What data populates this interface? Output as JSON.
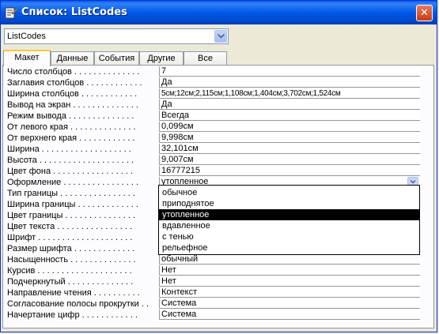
{
  "window": {
    "title": "Список: ListCodes"
  },
  "object_select": {
    "value": "ListCodes"
  },
  "tabs": [
    "Макет",
    "Данные",
    "События",
    "Другие",
    "Все"
  ],
  "active_tab": "Макет",
  "properties": [
    {
      "label": "Число столбцов . . . . . . . . . . . . . .",
      "value": "7"
    },
    {
      "label": "Заглавия столбцов . . . . . . . . . . . .",
      "value": "Да"
    },
    {
      "label": "Ширина столбцов . . . . . . . . . . . .",
      "value": "5см;12см;2,115см;1,108см;1,404см;3,702см;1,524см"
    },
    {
      "label": "Вывод на экран . . . . . . . . . . . . . .",
      "value": "Да"
    },
    {
      "label": "Режим вывода . . . . . . . . . . . . . .",
      "value": "Всегда"
    },
    {
      "label": "От левого края . . . . . . . . . . . . . .",
      "value": "0,099см"
    },
    {
      "label": "От верхнего края . . . . . . . . . . . .",
      "value": "9,998см"
    },
    {
      "label": "Ширина . . . . . . . . . . . . . . . . . . .",
      "value": "32,101см"
    },
    {
      "label": "Высота . . . . . . . . . . . . . . . . . . . .",
      "value": "9,007см"
    },
    {
      "label": "Цвет фона . . . . . . . . . . . . . . . . .",
      "value": "16777215"
    },
    {
      "label": "Оформление . . . . . . . . . . . . . . . .",
      "value": "утопленное"
    },
    {
      "label": "Тип границы . . . . . . . . . . . . . . . .",
      "value": ""
    },
    {
      "label": "Ширина границы . . . . . . . . . . . . .",
      "value": ""
    },
    {
      "label": "Цвет границы . . . . . . . . . . . . . . .",
      "value": ""
    },
    {
      "label": "Цвет текста . . . . . . . . . . . . . . . .",
      "value": ""
    },
    {
      "label": "Шрифт . . . . . . . . . . . . . . . . . . . .",
      "value": ""
    },
    {
      "label": "Размер шрифта . . . . . . . . . . . . .",
      "value": ""
    },
    {
      "label": "Насыщенность . . . . . . . . . . . . . .",
      "value": "обычный"
    },
    {
      "label": "Курсив . . . . . . . . . . . . . . . . . . . .",
      "value": "Нет"
    },
    {
      "label": "Подчеркнутый . . . . . . . . . . . . . .",
      "value": "Нет"
    },
    {
      "label": "Направление чтения . . . . . . . . . .",
      "value": "Контекст"
    },
    {
      "label": "Согласование полосы прокрутки . .",
      "value": "Система"
    },
    {
      "label": "Начертание цифр . . . . . . . . . . . .",
      "value": "Система"
    }
  ],
  "dropdown": {
    "options": [
      "обычное",
      "приподнятое",
      "утопленное",
      "вдавленное",
      "с тенью",
      "рельефное"
    ],
    "selected": "утопленное"
  },
  "icons": {
    "title_icon": "properties-icon",
    "close": "close-icon",
    "combo_arrow": "chevron-down-icon"
  },
  "colors": {
    "titlebar": "#0058e6",
    "selection": "#000000",
    "active_tab_accent": "#ffc83c"
  }
}
